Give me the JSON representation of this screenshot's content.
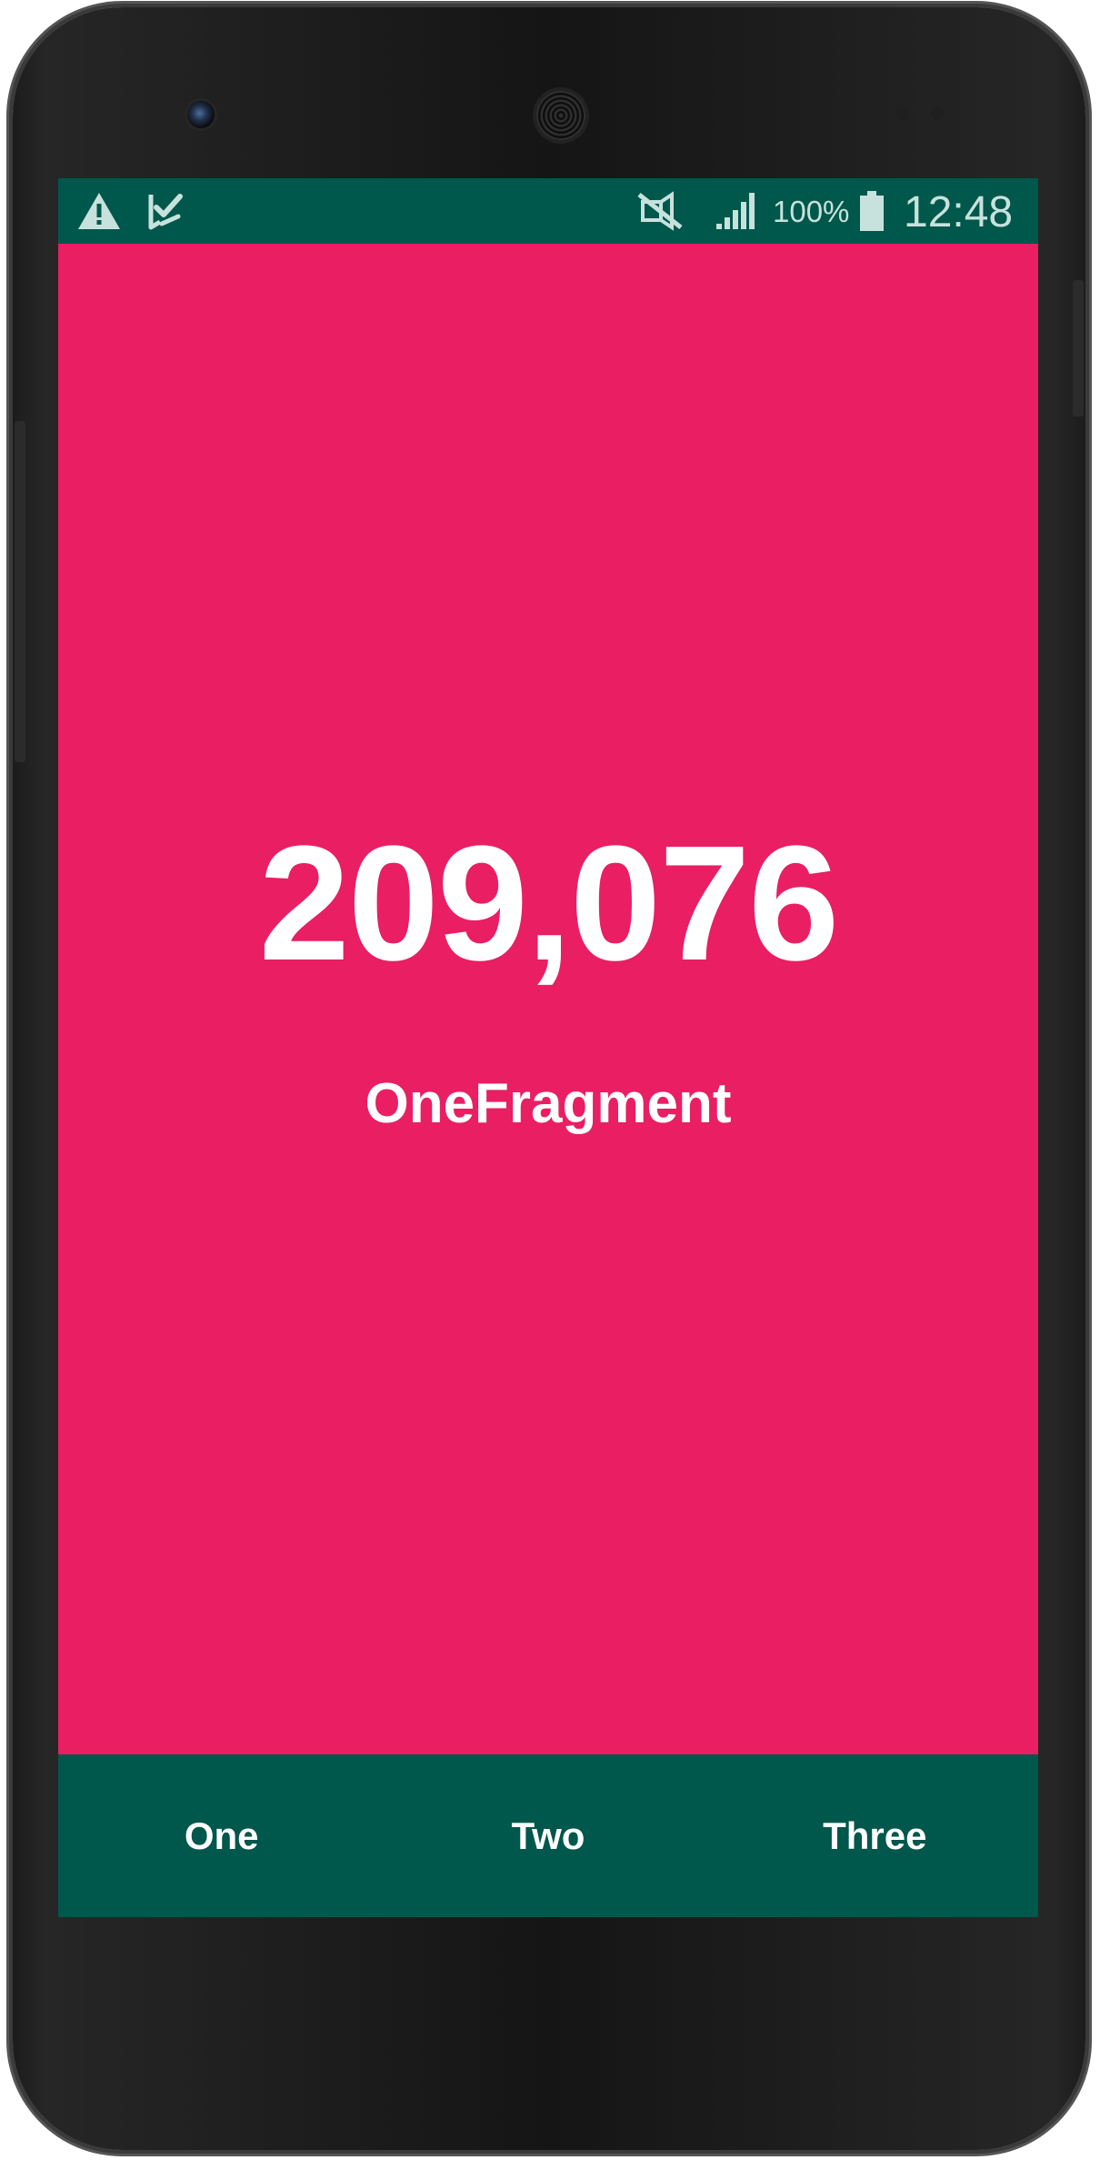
{
  "colors": {
    "primary_dark": "#00574b",
    "accent": "#e91e63",
    "text_on_primary": "#ffffff",
    "status_text": "#c7e2dd",
    "device_frame": "#151515"
  },
  "status_bar": {
    "left_icons": [
      "alert-icon",
      "task-check-icon"
    ],
    "right_icons": [
      "mute-icon",
      "signal-icon",
      "battery-icon"
    ],
    "battery_percent": "100%",
    "time": "12:48"
  },
  "content": {
    "counter": "209,076",
    "fragment_name": "OneFragment"
  },
  "bottom_nav": {
    "tabs": [
      {
        "label": "One",
        "selected": true
      },
      {
        "label": "Two",
        "selected": false
      },
      {
        "label": "Three",
        "selected": false
      }
    ]
  }
}
